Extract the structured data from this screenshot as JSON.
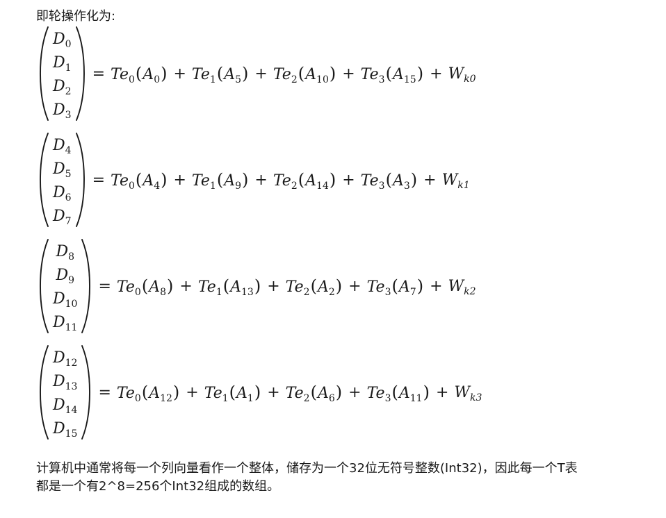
{
  "intro": "即轮操作化为:",
  "equations": [
    {
      "d": [
        "0",
        "1",
        "2",
        "3"
      ],
      "a": [
        "0",
        "5",
        "10",
        "15"
      ],
      "w": "k0"
    },
    {
      "d": [
        "4",
        "5",
        "6",
        "7"
      ],
      "a": [
        "4",
        "9",
        "14",
        "3"
      ],
      "w": "k1"
    },
    {
      "d": [
        "8",
        "9",
        "10",
        "11"
      ],
      "a": [
        "8",
        "13",
        "2",
        "7"
      ],
      "w": "k2"
    },
    {
      "d": [
        "12",
        "13",
        "14",
        "15"
      ],
      "a": [
        "12",
        "1",
        "6",
        "11"
      ],
      "w": "k3"
    }
  ],
  "symbols": {
    "d": "D",
    "te": "Te",
    "a": "A",
    "w": "W",
    "te_indices": [
      "0",
      "1",
      "2",
      "3"
    ]
  },
  "footer": {
    "line1": "计算机中通常将每一个列向量看作一个整体，储存为一个32位无符号整数(Int32)，因此每一个T表",
    "line2": "都是一个有2^8=256个Int32组成的数组。"
  }
}
